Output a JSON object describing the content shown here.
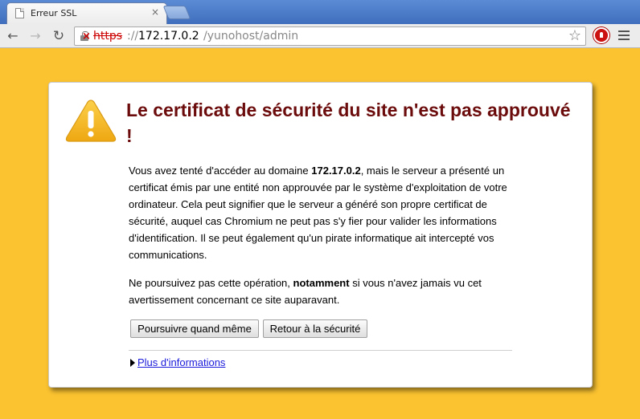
{
  "browser": {
    "tab_title": "Erreur SSL",
    "tab_close": "×",
    "url_scheme": "https",
    "url_separator": "://",
    "url_host": "172.17.0.2",
    "url_path": "/yunohost/admin",
    "nav": {
      "back": "←",
      "forward": "→",
      "reload": "↻"
    },
    "star": "☆"
  },
  "error": {
    "title": "Le certificat de sécurité du site n'est pas approuvé !",
    "para1_a": "Vous avez tenté d'accéder au domaine ",
    "para1_host": "172.17.0.2",
    "para1_b": ", mais le serveur a présenté un certificat émis par une entité non approuvée par le système d'exploitation de votre ordinateur. Cela peut signifier que le serveur a généré son propre certificat de sécurité, auquel cas Chromium ne peut pas s'y fier pour valider les informations d'identification. Il se peut également qu'un pirate informatique ait intercepté vos communications.",
    "para2_a": "Ne poursuivez pas cette opération, ",
    "para2_bold": "notamment",
    "para2_b": " si vous n'avez jamais vu cet avertissement concernant ce site auparavant.",
    "proceed_label": "Poursuivre quand même",
    "back_label": "Retour à la sécurité",
    "more_info_label": "Plus d'informations"
  },
  "colors": {
    "page_background": "#fbc330",
    "title": "#6b0b0b",
    "warning_triangle": "#f4b41b",
    "link": "#1a1adb"
  },
  "icons": [
    "warning-triangle-icon",
    "page-icon",
    "lock-broken-icon",
    "star-icon",
    "adblock-icon",
    "menu-icon"
  ]
}
